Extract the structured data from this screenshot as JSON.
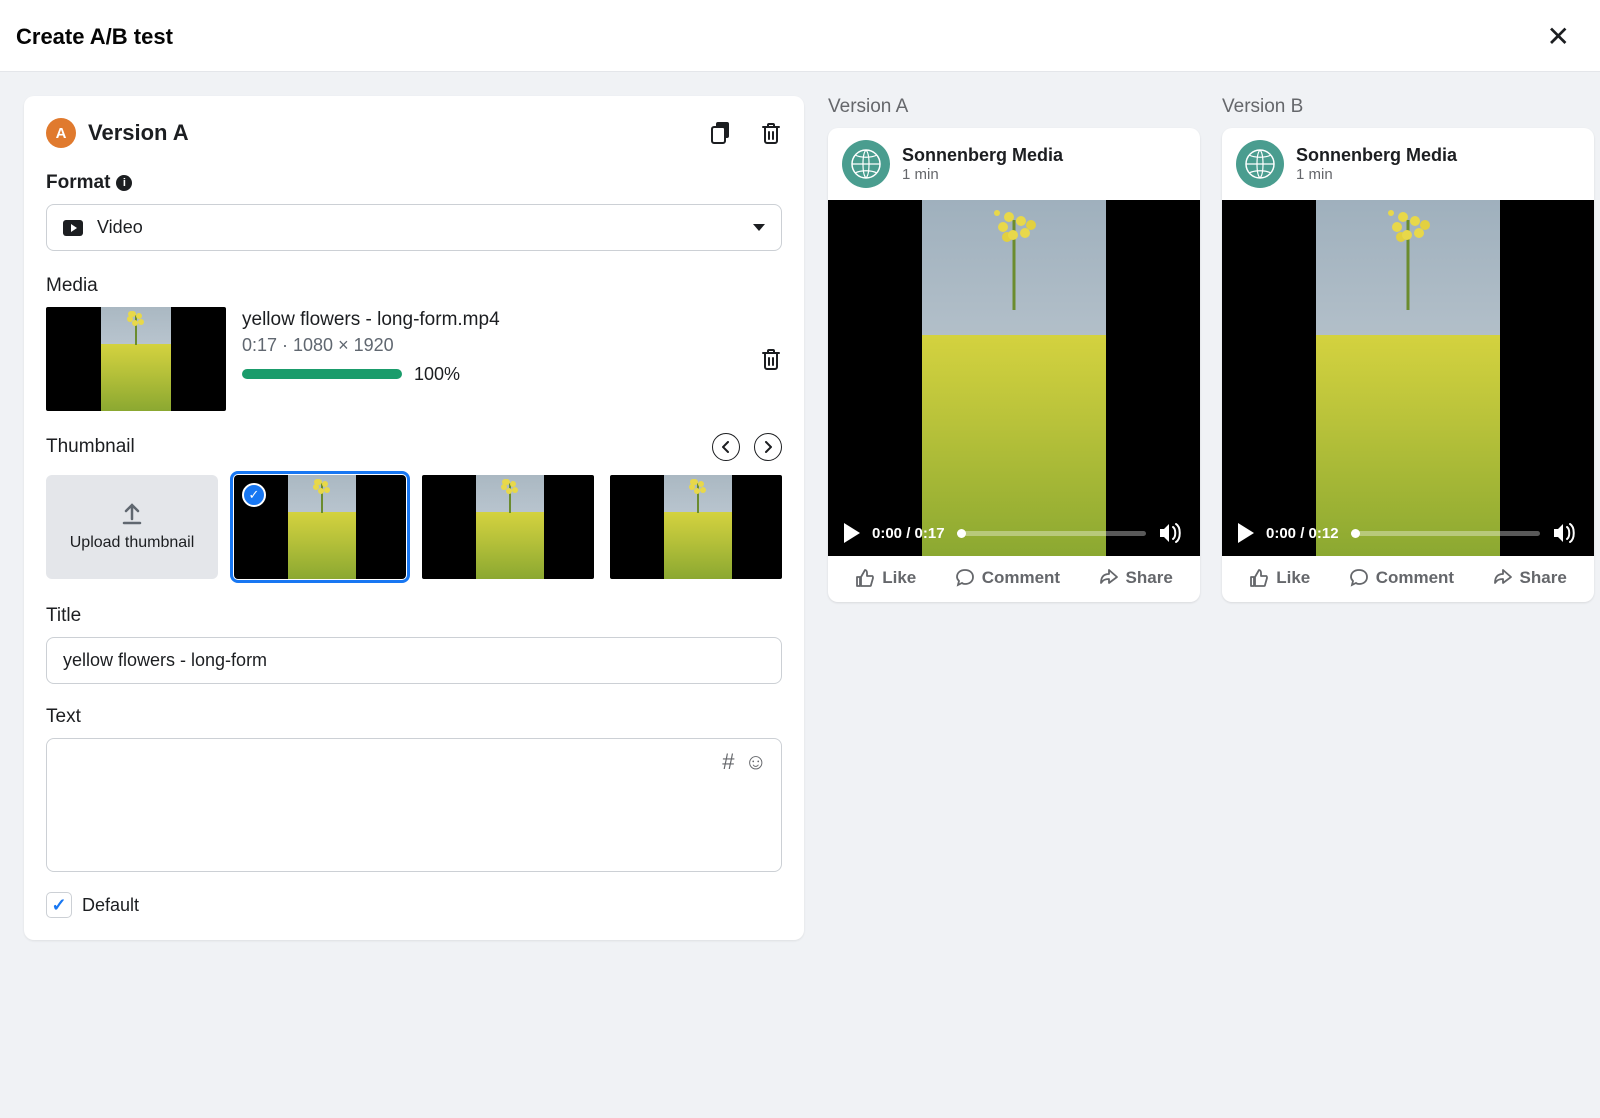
{
  "header": {
    "title": "Create A/B test"
  },
  "panel": {
    "badge": "A",
    "title": "Version A",
    "format_label": "Format",
    "format_value": "Video",
    "media_label": "Media",
    "media": {
      "filename": "yellow flowers - long-form.mp4",
      "meta": "0:17 · 1080 × 1920",
      "progress_pct": "100%"
    },
    "thumbnail_label": "Thumbnail",
    "upload_thumbnail_label": "Upload thumbnail",
    "title_label": "Title",
    "title_value": "yellow flowers - long-form",
    "text_label": "Text",
    "text_value": "",
    "default_label": "Default",
    "default_checked": true
  },
  "previews": {
    "a": {
      "label": "Version A",
      "author": "Sonnenberg Media",
      "time": "1 min",
      "video_time": "0:00 / 0:17",
      "like": "Like",
      "comment": "Comment",
      "share": "Share"
    },
    "b": {
      "label": "Version B",
      "author": "Sonnenberg Media",
      "time": "1 min",
      "video_time": "0:00 / 0:12",
      "like": "Like",
      "comment": "Comment",
      "share": "Share"
    }
  }
}
